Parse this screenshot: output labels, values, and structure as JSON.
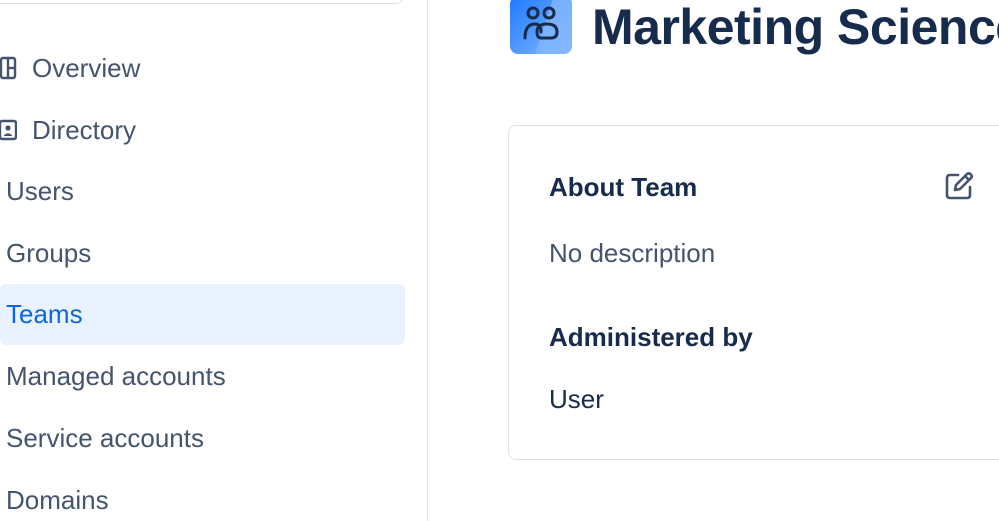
{
  "sidebar": {
    "items": [
      {
        "label": "Overview",
        "icon": "overview-icon"
      },
      {
        "label": "Directory",
        "icon": "directory-icon"
      },
      {
        "label": "Users"
      },
      {
        "label": "Groups"
      },
      {
        "label": "Teams",
        "selected": true
      },
      {
        "label": "Managed accounts"
      },
      {
        "label": "Service accounts"
      },
      {
        "label": "Domains"
      }
    ]
  },
  "team": {
    "name": "Marketing Science",
    "icon": "team-people-icon"
  },
  "about": {
    "heading": "About Team",
    "description": "No description",
    "edit_icon": "edit-icon",
    "admin_heading": "Administered by",
    "admin_value": "User"
  },
  "colors": {
    "accent": "#0c66e4",
    "selected_bg": "#e9f2ff",
    "text_primary": "#172b4d",
    "text_secondary": "#44546f",
    "border": "#dfe1e6"
  }
}
